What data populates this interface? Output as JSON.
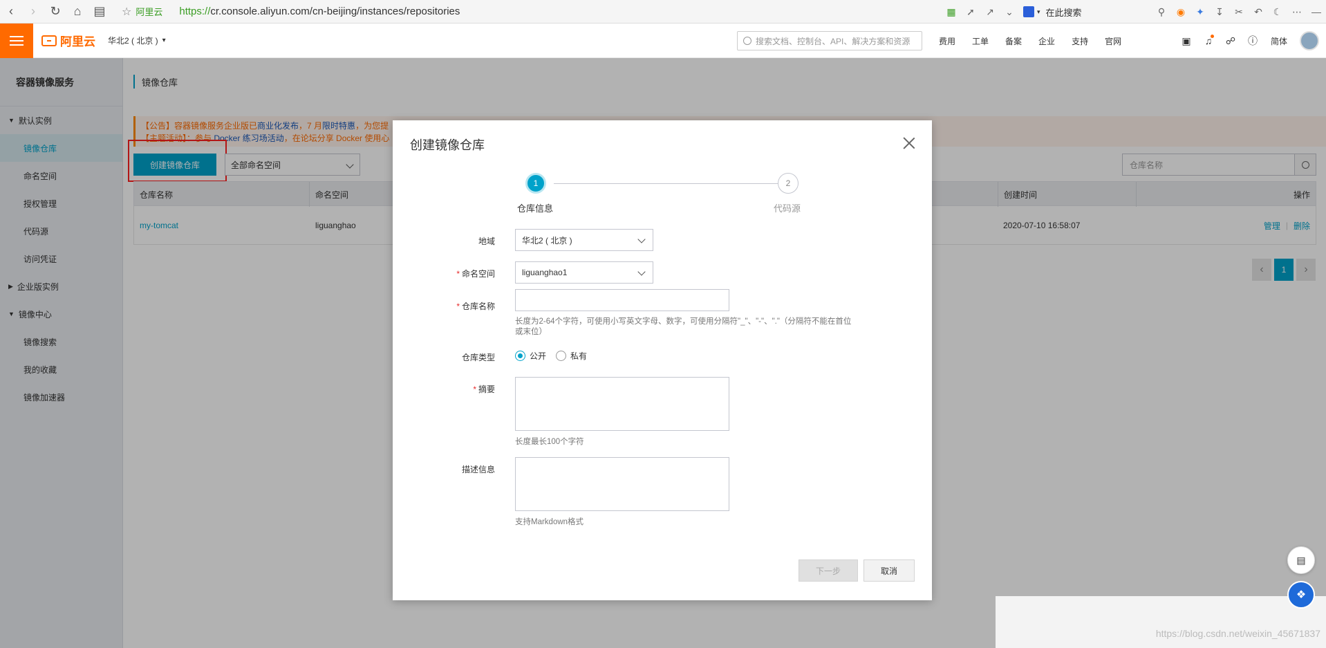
{
  "browser": {
    "site_name": "阿里云",
    "url_proto": "https://",
    "url_rest": "cr.console.aliyun.com/cn-beijing/instances/repositories",
    "search_label": "在此搜索"
  },
  "header": {
    "logo_text": "阿里云",
    "region": "华北2 ( 北京 )",
    "search_placeholder": "搜索文档、控制台、API、解决方案和资源",
    "links": [
      "费用",
      "工单",
      "备案",
      "企业",
      "支持",
      "官网"
    ],
    "lang": "简体",
    "accent_color": "#ff6a00"
  },
  "sidebar": {
    "title": "容器镜像服务",
    "groups": [
      {
        "label": "默认实例",
        "items": [
          "镜像仓库",
          "命名空间",
          "授权管理",
          "代码源",
          "访问凭证"
        ]
      },
      {
        "label": "企业版实例",
        "items": []
      },
      {
        "label": "镜像中心",
        "items": [
          "镜像搜索",
          "我的收藏",
          "镜像加速器"
        ]
      }
    ]
  },
  "main": {
    "breadcrumb": "镜像仓库",
    "notice_line1_a": "【公告】容器镜像服务企业版已",
    "notice_line1_b": "商业化发布",
    "notice_line1_c": "，7 月",
    "notice_line1_d": "限时特惠",
    "notice_line1_e": "，为您提",
    "notice_line2_a": "【主题活动】：参与 ",
    "notice_line2_b": "Docker 练习场活动",
    "notice_line2_c": "，在论坛分享 Docker 使用心",
    "create_button": "创建镜像仓库",
    "namespace_filter": "全部命名空间",
    "search_placeholder": "仓库名称",
    "table": {
      "headers": [
        "仓库名称",
        "命名空间",
        "创建时间",
        "操作"
      ],
      "rows": [
        {
          "name": "my-tomcat",
          "namespace": "liguanghao",
          "created": "2020-07-10 16:58:07",
          "op_manage": "管理",
          "op_delete": "删除"
        }
      ]
    },
    "pager_current": "1"
  },
  "modal": {
    "title": "创建镜像仓库",
    "steps": [
      {
        "num": "1",
        "label": "仓库信息"
      },
      {
        "num": "2",
        "label": "代码源"
      }
    ],
    "region_label": "地域",
    "region_value": "华北2 ( 北京 )",
    "namespace_label": "命名空间",
    "namespace_value": "liguanghao1",
    "repo_name_label": "仓库名称",
    "repo_name_help_1": "长度为2-64个字符，可使用小写英文字母、数字，可使用分隔符\"_\"、\"-\"、\".\"（分隔符不能在首位",
    "repo_name_help_2": "或末位）",
    "repo_type_label": "仓库类型",
    "repo_type_public": "公开",
    "repo_type_private": "私有",
    "summary_label": "摘要",
    "summary_help": "长度最长100个字符",
    "desc_label": "描述信息",
    "desc_help": "支持Markdown格式",
    "next_button": "下一步",
    "cancel_button": "取消"
  },
  "watermark": "https://blog.csdn.net/weixin_45671837"
}
